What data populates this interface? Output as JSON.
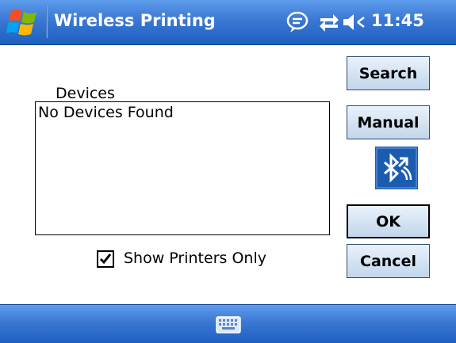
{
  "window": {
    "title": "Wireless Printing",
    "clock": "11:45"
  },
  "icons": {
    "start": "windows-flag-icon",
    "tray": [
      "speech-bubble-icon",
      "connectivity-arrows-icon",
      "speaker-icon"
    ],
    "bluetooth": "bluetooth-icon",
    "keyboard": "keyboard-icon"
  },
  "devices": {
    "label": "Devices",
    "empty_text": "No Devices Found"
  },
  "filter": {
    "label": "Show Printers Only",
    "checked": true
  },
  "buttons": {
    "search": "Search",
    "manual": "Manual",
    "ok": "OK",
    "cancel": "Cancel"
  },
  "colors": {
    "bar_blue": "#3a78d4",
    "button_face": "#d3e2f2",
    "bluetooth_bg": "#1c5cb0"
  }
}
